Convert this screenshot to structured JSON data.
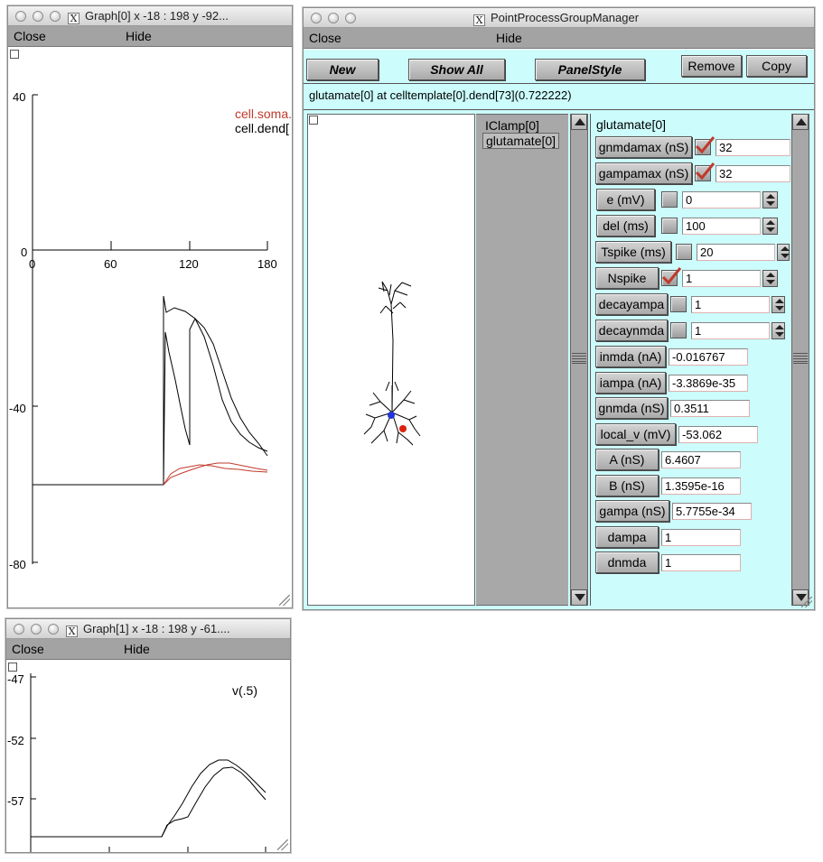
{
  "graph0": {
    "title": "Graph[0]  x -18 : 198  y -92...",
    "menu": {
      "close": "Close",
      "hide": "Hide"
    },
    "y_ticks": [
      "40",
      "0",
      "-40",
      "-80"
    ],
    "x_ticks": [
      "0",
      "60",
      "120",
      "180"
    ],
    "legend": [
      {
        "label": "cell.soma.",
        "color": "#c0392b"
      },
      {
        "label": "cell.dend[",
        "color": "#000000"
      }
    ]
  },
  "graph1": {
    "title": "Graph[1]  x -18 : 198  y -61....",
    "menu": {
      "close": "Close",
      "hide": "Hide"
    },
    "y_ticks": [
      "-47",
      "-52",
      "-57"
    ],
    "legend": [
      {
        "label": "v(.5)",
        "color": "#000000"
      }
    ]
  },
  "ppgm": {
    "title": "PointProcessGroupManager",
    "menu": {
      "close": "Close",
      "hide": "Hide"
    },
    "toolbar": {
      "new": "New",
      "show_all": "Show All",
      "panel_style": "PanelStyle",
      "remove": "Remove",
      "copy": "Copy"
    },
    "location": "glutamate[0] at celltemplate[0].dend[73](0.722222)",
    "process_list": [
      "IClamp[0]",
      "glutamate[0]"
    ],
    "panel_title": "glutamate[0]",
    "params": [
      {
        "label": "gnmdamax (nS)",
        "checked": true,
        "value": "32",
        "spinner": false
      },
      {
        "label": "gampamax (nS)",
        "checked": true,
        "value": "32",
        "spinner": false
      },
      {
        "label": "e (mV)",
        "checked": false,
        "value": "0",
        "spinner": true
      },
      {
        "label": "del (ms)",
        "checked": false,
        "value": "100",
        "spinner": true
      },
      {
        "label": "Tspike (ms)",
        "checked": false,
        "value": "20",
        "spinner": true
      },
      {
        "label": "Nspike",
        "checked": true,
        "value": "1",
        "spinner": true
      },
      {
        "label": "decayampa",
        "checked": false,
        "value": "1",
        "spinner": true
      },
      {
        "label": "decaynmda",
        "checked": false,
        "value": "1",
        "spinner": true
      }
    ],
    "readouts": [
      {
        "label": "inmda (nA)",
        "value": "-0.016767"
      },
      {
        "label": "iampa (nA)",
        "value": "-3.3869e-35"
      },
      {
        "label": "gnmda (nS)",
        "value": "0.3511"
      },
      {
        "label": "local_v (mV)",
        "value": "-53.062"
      },
      {
        "label": "A (nS)",
        "value": "6.4607"
      },
      {
        "label": "B (nS)",
        "value": "1.3595e-16"
      },
      {
        "label": "gampa (nS)",
        "value": "5.7755e-34"
      },
      {
        "label": "dampa",
        "value": "1"
      },
      {
        "label": "dnmda",
        "value": "1"
      }
    ]
  },
  "colors": {
    "panel_bg": "#ccfcfc",
    "menu_bg": "#a3a3a3",
    "soma_trace": "#c0392b",
    "check_mark": "#c0392b",
    "synapse_marker": "#2233dd",
    "clamp_marker": "#dd2211"
  }
}
